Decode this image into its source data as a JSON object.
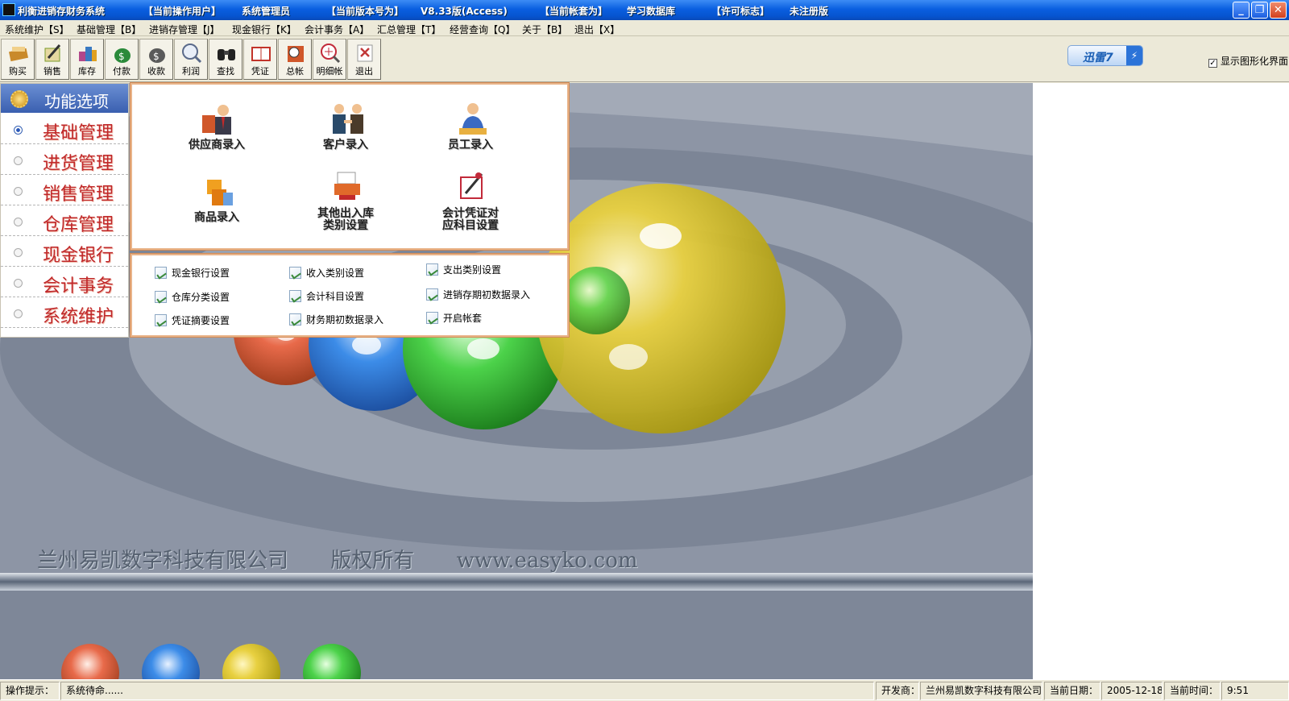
{
  "titlebar": {
    "app_title": "利衡进销存财务系统",
    "user_label": "【当前操作用户】",
    "user_value": "系统管理员",
    "version_label": "【当前版本号为】",
    "version_value": "V8.33版(Access)",
    "account_label": "【当前帐套为】",
    "account_value": "学习数据库",
    "license_label": "【许可标志】",
    "license_value": "未注册版",
    "minimize": "_",
    "restore": "❐",
    "close": "✕"
  },
  "menu": [
    {
      "label": "系统维护【S】"
    },
    {
      "label": "基础管理【B】"
    },
    {
      "label": "进销存管理【J】"
    },
    {
      "label": "现金银行【K】"
    },
    {
      "label": "会计事务【A】"
    },
    {
      "label": "汇总管理【T】"
    },
    {
      "label": "经营查询【Q】"
    },
    {
      "label": "关于【B】"
    },
    {
      "label": "退出【X】"
    }
  ],
  "toolbar": [
    {
      "label": "购买",
      "icon": "buy-icon",
      "color": "#c98a2b"
    },
    {
      "label": "销售",
      "icon": "sales-icon",
      "color": "#7a9a2a"
    },
    {
      "label": "库存",
      "icon": "inventory-icon",
      "color": "#b2478a"
    },
    {
      "label": "付款",
      "icon": "payment-icon",
      "color": "#2a8a3a"
    },
    {
      "label": "收款",
      "icon": "receipt-icon",
      "color": "#3a3a3a"
    },
    {
      "label": "利润",
      "icon": "profit-icon",
      "color": "#5a6a8a"
    },
    {
      "label": "查找",
      "icon": "binoculars-icon",
      "color": "#2a2a2a"
    },
    {
      "label": "凭证",
      "icon": "voucher-icon",
      "color": "#c2342a"
    },
    {
      "label": "总帐",
      "icon": "ledger-icon",
      "color": "#d0572a"
    },
    {
      "label": "明细帐",
      "icon": "detail-ledger-icon",
      "color": "#c22a3a"
    },
    {
      "label": "退出",
      "icon": "exit-icon",
      "color": "#c23a3a"
    }
  ],
  "xunlei": {
    "label": "迅雷7",
    "badge": "⚡"
  },
  "graphic_toggle": {
    "checked": "✓",
    "label": "显示图形化界面"
  },
  "nav": {
    "header": "功能选项",
    "items": [
      {
        "label": "基础管理",
        "selected": true
      },
      {
        "label": "进货管理",
        "selected": false
      },
      {
        "label": "销售管理",
        "selected": false
      },
      {
        "label": "仓库管理",
        "selected": false
      },
      {
        "label": "现金银行",
        "selected": false
      },
      {
        "label": "会计事务",
        "selected": false
      },
      {
        "label": "系统维护",
        "selected": false
      }
    ]
  },
  "big_buttons": [
    {
      "line1": "供应商录入",
      "line2": "",
      "icon": "supplier-icon"
    },
    {
      "line1": "客户录入",
      "line2": "",
      "icon": "customer-icon"
    },
    {
      "line1": "员工录入",
      "line2": "",
      "icon": "employee-icon"
    },
    {
      "line1": "商品录入",
      "line2": "",
      "icon": "goods-icon"
    },
    {
      "line1": "其他出入库",
      "line2": "类别设置",
      "icon": "stock-category-icon"
    },
    {
      "line1": "会计凭证对",
      "line2": "应科目设置",
      "icon": "voucher-subject-icon"
    }
  ],
  "links": [
    {
      "label": "现金银行设置"
    },
    {
      "label": "收入类别设置"
    },
    {
      "label": "支出类别设置"
    },
    {
      "label": "仓库分类设置"
    },
    {
      "label": "会计科目设置"
    },
    {
      "label": "进销存期初数据录入"
    },
    {
      "label": "凭证摘要设置"
    },
    {
      "label": "财务期初数据录入"
    },
    {
      "label": "开启帐套"
    }
  ],
  "watermark": {
    "company": "兰州易凯数字科技有限公司",
    "rights": "版权所有",
    "url": "www.easyko.com"
  },
  "statusbar": {
    "hint_label": "操作提示：",
    "hint_value": "系统待命......",
    "dev_label": "开发商：",
    "dev_value": "兰州易凯数字科技有限公司",
    "date_label": "当前日期：",
    "date_value": "2005-12-18",
    "time_label": "当前时间：",
    "time_value": "9:51"
  },
  "colors": {
    "titlebar": "#0a5fe0",
    "nav_text": "#c0282a",
    "panel_border": "#e8b48a",
    "background": "#8a93a4"
  }
}
